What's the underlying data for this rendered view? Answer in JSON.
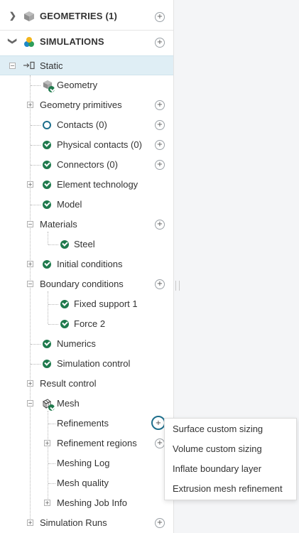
{
  "sections": [
    {
      "label": "GEOMETRIES (1)"
    },
    {
      "label": "SIMULATIONS"
    }
  ],
  "tree": {
    "static": "Static",
    "geometry": "Geometry",
    "geometry_primitives": "Geometry primitives",
    "contacts": "Contacts (0)",
    "physical_contacts": "Physical contacts (0)",
    "connectors": "Connectors (0)",
    "element_technology": "Element technology",
    "model": "Model",
    "materials": "Materials",
    "steel": "Steel",
    "initial_conditions": "Initial conditions",
    "boundary_conditions": "Boundary conditions",
    "fixed_support": "Fixed support 1",
    "force": "Force 2",
    "numerics": "Numerics",
    "simulation_control": "Simulation control",
    "result_control": "Result control",
    "mesh": "Mesh",
    "refinements": "Refinements",
    "refinement_regions": "Refinement regions",
    "meshing_log": "Meshing Log",
    "mesh_quality": "Mesh quality",
    "meshing_job_info": "Meshing Job Info",
    "simulation_runs": "Simulation Runs"
  },
  "context_menu": {
    "items": [
      "Surface custom sizing",
      "Volume custom sizing",
      "Inflate boundary layer",
      "Extrusion mesh refinement"
    ]
  },
  "colors": {
    "accent": "#1e6f8c",
    "check": "#1f7a4d",
    "selected_row": "#dfeef5"
  }
}
